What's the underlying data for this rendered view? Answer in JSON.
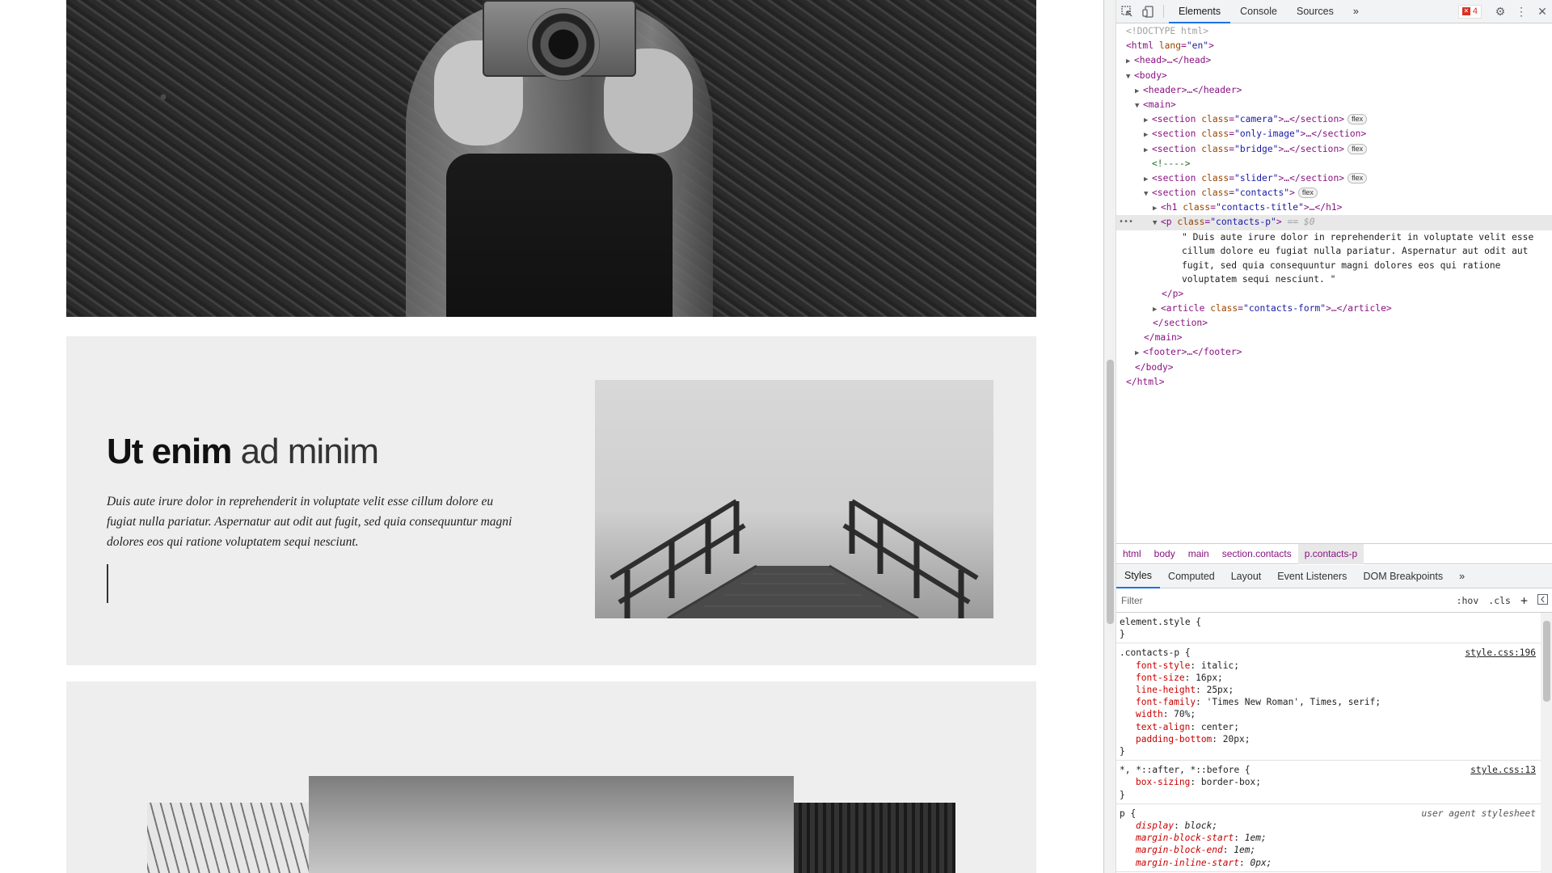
{
  "page": {
    "bridge": {
      "title_bold": "Ut enim",
      "title_light": "ad minim",
      "text": "Duis aute irure dolor in reprehenderit in voluptate velit esse cillum dolore eu fugiat nulla pariatur. Aspernatur aut odit aut fugit, sed quia consequuntur magni dolores eos qui ratione voluptatem sequi nesciunt."
    }
  },
  "devtools": {
    "tabs": [
      "Elements",
      "Console",
      "Sources"
    ],
    "more_tabs": "»",
    "error_count": "4",
    "tree": {
      "doctype": "<!DOCTYPE html>",
      "html_open": "<html",
      "lang_attr": "lang",
      "lang_val": "\"en\"",
      "head": "<head>…</head>",
      "body_open": "<body>",
      "header": "<header>…</header>",
      "main_open": "<main>",
      "section_camera": "\"camera\"",
      "section_only_image": "\"only-image\"",
      "section_bridge": "\"bridge\"",
      "comment": "<!---->",
      "section_slider": "\"slider\"",
      "section_contacts": "\"contacts\"",
      "h1_class": "\"contacts-title\"",
      "p_class": "\"contacts-p\"",
      "p_marker": "== $0",
      "p_text": "\" Duis aute irure dolor in reprehenderit in voluptate velit esse cillum dolore eu fugiat nulla pariatur. Aspernatur aut odit aut fugit, sed quia consequuntur magni dolores eos qui ratione voluptatem sequi nesciunt. \"",
      "p_close": "</p>",
      "article_class": "\"contacts-form\"",
      "section_close": "</section>",
      "main_close": "</main>",
      "footer": "<footer>…</footer>",
      "body_close": "</body>",
      "html_close": "</html>",
      "flex_badge": "flex"
    },
    "breadcrumbs": [
      "html",
      "body",
      "main",
      "section.contacts",
      "p.contacts-p"
    ],
    "subtabs": [
      "Styles",
      "Computed",
      "Layout",
      "Event Listeners",
      "DOM Breakpoints"
    ],
    "subtabs_more": "»",
    "filter": {
      "placeholder": "Filter",
      "hov": ":hov",
      "cls": ".cls",
      "add": "+"
    },
    "styles": {
      "element_style": "element.style {",
      "close_brace": "}",
      "contacts_rule": {
        "selector": ".contacts-p {",
        "source": "style.css:196",
        "props": [
          {
            "name": "font-style",
            "value": "italic;"
          },
          {
            "name": "font-size",
            "value": "16px;"
          },
          {
            "name": "line-height",
            "value": "25px;"
          },
          {
            "name": "font-family",
            "value": "'Times New Roman', Times, serif;"
          },
          {
            "name": "width",
            "value": "70%;"
          },
          {
            "name": "text-align",
            "value": "center;"
          },
          {
            "name": "padding-bottom",
            "value": "20px;"
          }
        ]
      },
      "universal_rule": {
        "selector": "*, *::after, *::before {",
        "source": "style.css:13",
        "props": [
          {
            "name": "box-sizing",
            "value": "border-box;"
          }
        ]
      },
      "ua_rule": {
        "selector": "p {",
        "source": "user agent stylesheet",
        "props": [
          {
            "name": "display",
            "value": "block;"
          },
          {
            "name": "margin-block-start",
            "value": "1em;"
          },
          {
            "name": "margin-block-end",
            "value": "1em;"
          },
          {
            "name": "margin-inline-start",
            "value": "0px;"
          }
        ]
      }
    }
  }
}
